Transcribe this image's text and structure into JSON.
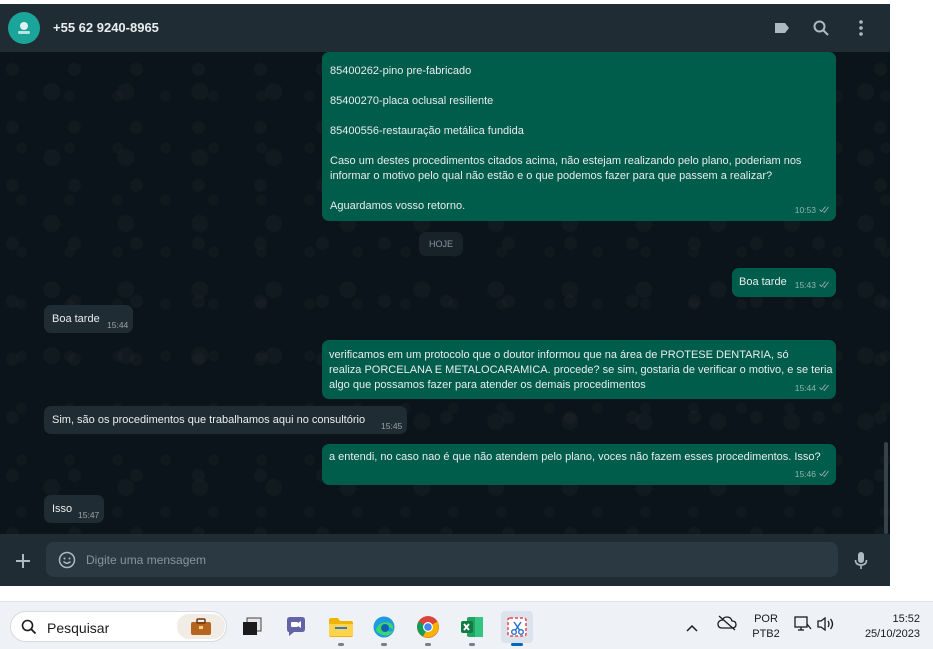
{
  "header": {
    "contact_name": "+55 62 9240-8965",
    "icons": [
      "label-icon",
      "search-icon",
      "more-vertical-icon"
    ]
  },
  "messages": {
    "first_bubble_lines": [
      "85400262-pino pre-fabricado",
      "",
      "85400270-placa oclusal resiliente",
      "",
      "85400556-restauração metálica fundida",
      "",
      "Caso um destes procedimentos citados acima, não estejam realizando pelo plano, poderiam nos",
      "informar o motivo pelo qual não estão e o que podemos fazer para que passem a realizar?",
      "",
      "Aguardamos vosso retorno."
    ],
    "first_bubble_time": "10:53",
    "day_chip": "HOJE",
    "m1_text": "Boa tarde",
    "m1_time": "15:43",
    "m2_text": "Boa tarde",
    "m2_time": "15:44",
    "m3_lines": [
      "verificamos em um protocolo que o doutor informou que na área  de PROTESE DENTARIA, só",
      "realiza PORCELANA E METALOCARAMICA.  procede? se sim, gostaria de verificar o motivo, e se teria",
      "algo que possamos fazer para atender os demais procedimentos"
    ],
    "m3_time": "15:44",
    "m4_text": "Sim, são os procedimentos que trabalhamos aqui no consultório",
    "m4_time": "15:45",
    "m5_text": "a entendi, no caso nao é que não atendem pelo plano, voces não fazem esses procedimentos. Isso?",
    "m5_time": "15:46",
    "m6_text": "Isso",
    "m6_time": "15:47"
  },
  "composer": {
    "placeholder": "Digite uma mensagem",
    "value": ""
  },
  "taskbar": {
    "search_placeholder": "Pesquisar",
    "apps": [
      "briefcase-icon",
      "task-view-icon",
      "chat-icon",
      "file-explorer-icon",
      "edge-icon",
      "chrome-icon",
      "excel-icon",
      "snipping-tool-icon"
    ],
    "language_line1": "POR",
    "language_line2": "PTB2",
    "time": "15:52",
    "date": "25/10/2023"
  },
  "colors": {
    "outgoing_bubble": "#005c4b",
    "incoming_bubble": "#202c33",
    "chat_background": "#0b141a",
    "header_background": "#202c33"
  }
}
